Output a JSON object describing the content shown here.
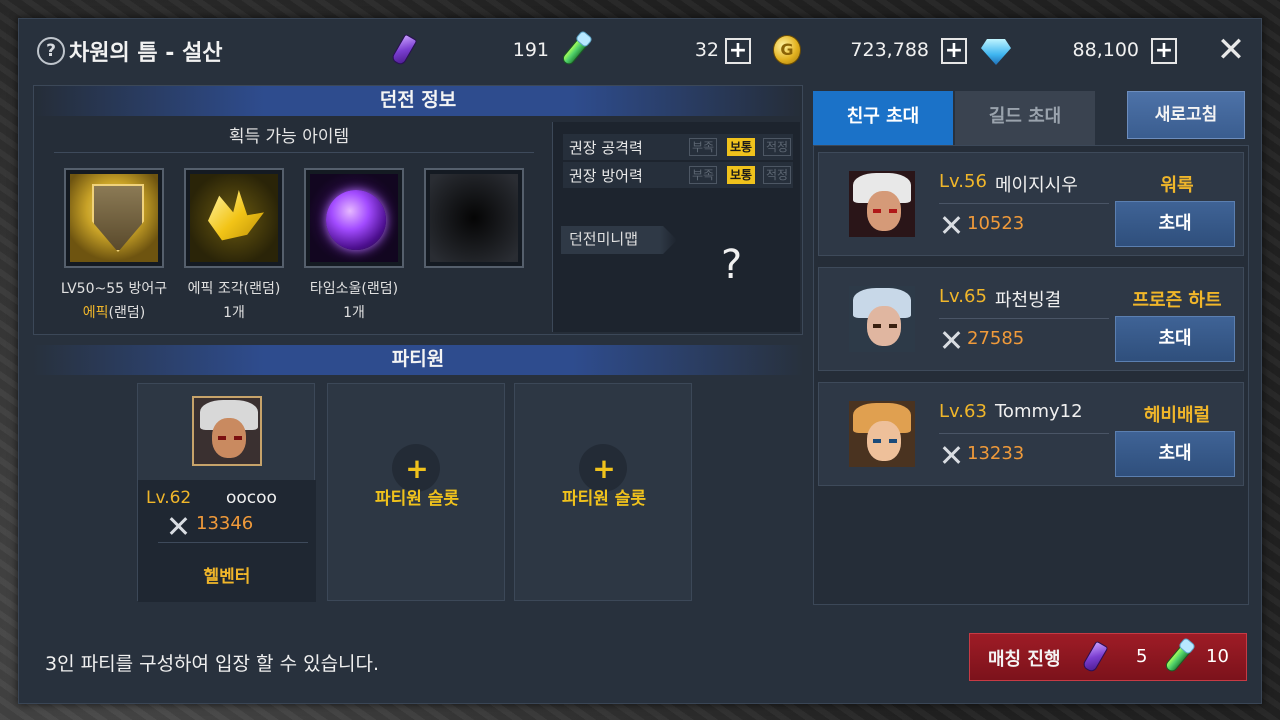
{
  "header": {
    "help_icon": "?",
    "title": "차원의 틈 - 설산",
    "resources": [
      {
        "icon": "crystal-icon",
        "value": "191"
      },
      {
        "icon": "potion-icon",
        "value": "32"
      },
      {
        "icon": "coin-icon",
        "value": "723,788"
      },
      {
        "icon": "diamond-icon",
        "value": "88,100"
      }
    ],
    "plus_label": "+",
    "close_label": "✕"
  },
  "dungeon_info": {
    "title": "던전 정보",
    "obtainable_title": "획득 가능 아이템",
    "items": [
      {
        "icon": "shield-icon",
        "line1": "LV50~55 방어구",
        "line2_epic": "에픽",
        "line2": "(랜덤)"
      },
      {
        "icon": "epic-shard-icon",
        "line1": "에픽 조각(랜덤)",
        "line2": "1개"
      },
      {
        "icon": "time-soul-icon",
        "line1": "타임소울(랜덤)",
        "line2": "1개"
      },
      {
        "icon": "empty-slot-icon"
      }
    ],
    "stats": [
      {
        "label": "권장 공격력",
        "tags": [
          "부족",
          "보통",
          "적정"
        ],
        "active": "보통"
      },
      {
        "label": "권장 방어력",
        "tags": [
          "부족",
          "보통",
          "적정"
        ],
        "active": "보통"
      }
    ],
    "minimap_label": "던전미니맵",
    "minimap_unknown": "?"
  },
  "party": {
    "title": "파티원",
    "leader": {
      "level": "Lv.62",
      "name": "oocoo",
      "power": "13346",
      "class": "헬벤터"
    },
    "empty_slot_plus": "+",
    "empty_slot_label": "파티원 슬롯"
  },
  "footer": {
    "info_text": "3인 파티를 구성하여 입장 할 수 있습니다.",
    "match_label": "매칭 진행",
    "match_crystal_cost": "5",
    "match_potion_cost": "10"
  },
  "invite": {
    "tab_friends": "친구 초대",
    "tab_guild": "길드 초대",
    "refresh_label": "새로고침",
    "invite_label": "초대",
    "friends": [
      {
        "level": "Lv.56",
        "name": "메이지시우",
        "power": "10523",
        "class": "워록"
      },
      {
        "level": "Lv.65",
        "name": "파천빙결",
        "power": "27585",
        "class": "프로즌 하트"
      },
      {
        "level": "Lv.63",
        "name": "Tommy12",
        "power": "13233",
        "class": "헤비배럴"
      }
    ]
  },
  "colors": {
    "accent_gold": "#f0b62a",
    "tab_active": "#1b72c8",
    "match_red": "#9e1c26",
    "power_orange": "#f09a3a"
  }
}
